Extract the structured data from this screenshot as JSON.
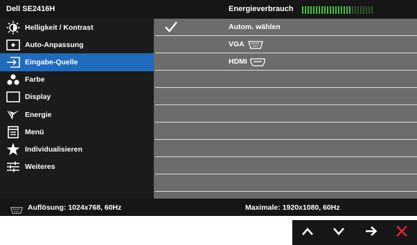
{
  "header": {
    "title": "Dell SE2416H",
    "energy_label": "Energieverbrauch",
    "energy_level": 0.69
  },
  "colors": {
    "selected": "#1f6bbd",
    "energy_active": "#45c33f",
    "energy_inactive": "#2e5a2a",
    "exit": "#e8252b"
  },
  "sidebar": {
    "items": [
      {
        "label": "Helligkeit / Kontrast",
        "icon": "brightness-icon"
      },
      {
        "label": "Auto-Anpassung",
        "icon": "auto-adjust-icon"
      },
      {
        "label": "Eingabe-Quelle",
        "icon": "input-source-icon",
        "selected": true
      },
      {
        "label": "Farbe",
        "icon": "color-icon"
      },
      {
        "label": "Display",
        "icon": "display-icon"
      },
      {
        "label": "Energie",
        "icon": "energy-icon"
      },
      {
        "label": "Menü",
        "icon": "menu-icon"
      },
      {
        "label": "Individualisieren",
        "icon": "star-icon"
      },
      {
        "label": "Weiteres",
        "icon": "others-icon"
      }
    ]
  },
  "options": {
    "auto_select": {
      "label": "Autom. wählen",
      "checked": true
    },
    "vga": {
      "label": "VGA",
      "icon": "vga-port-icon"
    },
    "hdmi": {
      "label": "HDMI",
      "icon": "hdmi-port-icon"
    }
  },
  "status": {
    "resolution": "Auflösung: 1024x768, 60Hz",
    "maximum": "Maximale: 1920x1080, 60Hz",
    "icon": "vga-port-icon"
  },
  "nav": {
    "up": "up-arrow-icon",
    "down": "down-arrow-icon",
    "enter": "right-arrow-icon",
    "exit": "close-icon"
  }
}
